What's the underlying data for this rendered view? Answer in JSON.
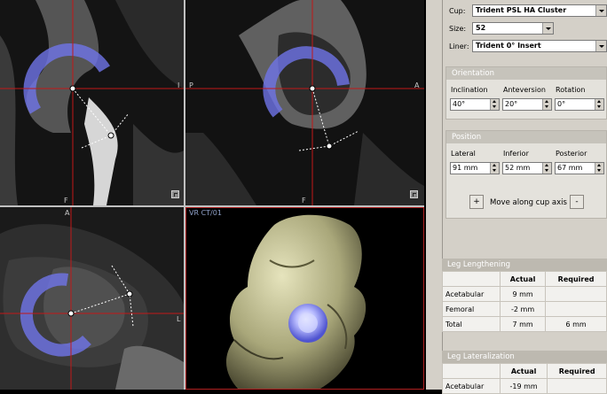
{
  "views": {
    "coronal": {
      "label_top": "I",
      "label_bottom": "F"
    },
    "sagittal": {
      "label_left": "P",
      "label_right": "A",
      "label_bottom": "F"
    },
    "axial": {
      "label_top": "A",
      "label_right": "L"
    },
    "volume": {
      "title": "VR CT/01"
    }
  },
  "implant": {
    "cup_label": "Cup:",
    "cup_value": "Trident PSL HA Cluster",
    "size_label": "Size:",
    "size_value": "52",
    "liner_label": "Liner:",
    "liner_value": "Trident 0° Insert"
  },
  "orientation": {
    "title": "Orientation",
    "inclination_label": "Inclination",
    "inclination_value": "40°",
    "anteversion_label": "Anteversion",
    "anteversion_value": "20°",
    "rotation_label": "Rotation",
    "rotation_value": "0°"
  },
  "position": {
    "title": "Position",
    "lateral_label": "Lateral",
    "lateral_value": "91 mm",
    "inferior_label": "Inferior",
    "inferior_value": "52 mm",
    "posterior_label": "Posterior",
    "posterior_value": "67 mm",
    "plus_label": "+",
    "move_label": "Move along cup axis",
    "minus_label": "-"
  },
  "leg_lengthening": {
    "title": "Leg Lengthening",
    "col_actual": "Actual",
    "col_required": "Required",
    "rows": [
      {
        "name": "Acetabular",
        "actual": "9 mm",
        "required": ""
      },
      {
        "name": "Femoral",
        "actual": "-2 mm",
        "required": ""
      },
      {
        "name": "Total",
        "actual": "7 mm",
        "required": "6 mm"
      }
    ]
  },
  "leg_lateralization": {
    "title": "Leg Lateralization",
    "col_actual": "Actual",
    "col_required": "Required",
    "rows": [
      {
        "name": "Acetabular",
        "actual": "-19 mm",
        "required": ""
      }
    ]
  },
  "colors": {
    "cup_overlay": "#6f74e8",
    "crosshair": "#c21818",
    "panel_bg": "#d4d0c8",
    "bone_3d": "#c9c79a"
  }
}
